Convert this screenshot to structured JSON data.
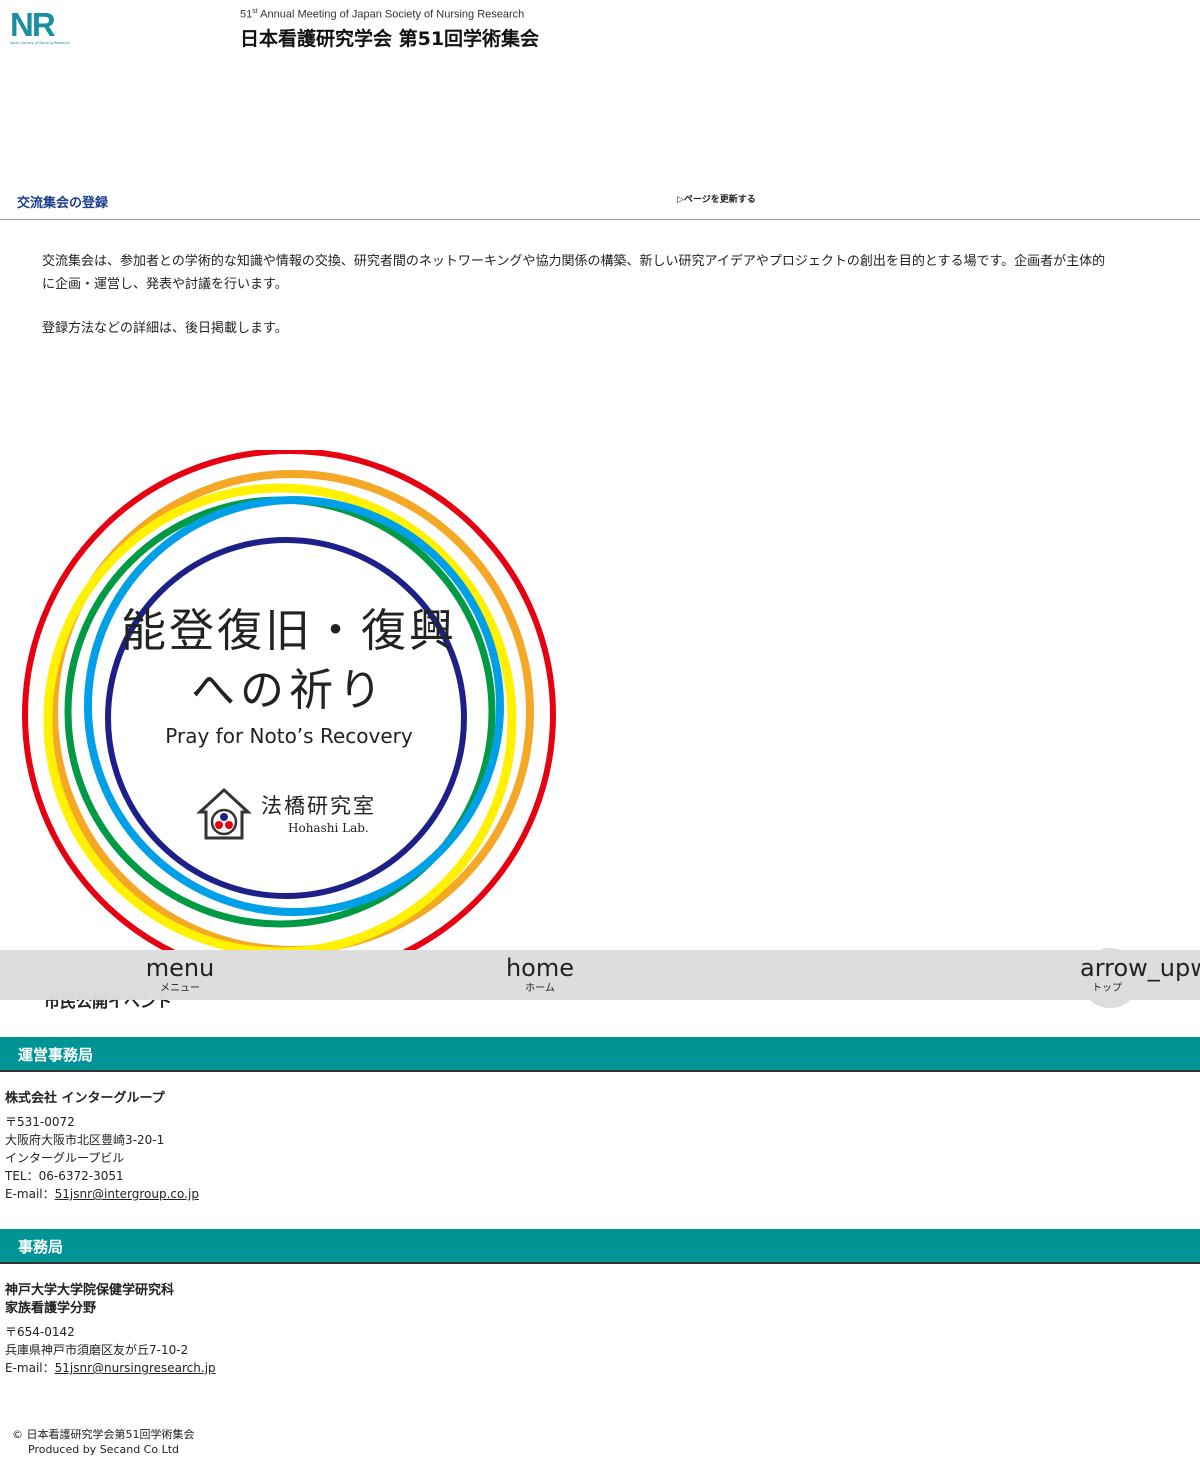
{
  "header": {
    "logo_text": "NR",
    "logo_sub": "Japan Society of Nursing Research",
    "subtitle_num": "51",
    "subtitle_sup": "st",
    "subtitle_rest": " Annual Meeting of Japan Society of Nursing Research",
    "site_title": "日本看護研究学会 第51回学術集会"
  },
  "page": {
    "heading": "交流集会の登録",
    "refresh_link": "▷ページを更新する",
    "intro_p1": "交流集会は、参加者との学術的な知識や情報の交換、研究者間のネットワーキングや協力関係の構築、新しい研究アイデアやプロジェクトの創出を目的とする場です。企画者が主体的に企画・運営し、発表や討議を行います。",
    "intro_p2": "登録方法などの詳細は、後日掲載します。"
  },
  "banner": {
    "line1": "能登復旧・復興",
    "line2": "への祈り",
    "line3": "Pray for Noto’s Recovery",
    "lab_jp": "法橋研究室",
    "lab_en": "Hohashi Lab.",
    "ring_colors": [
      "#e60012",
      "#f39800",
      "#fff100",
      "#009944",
      "#00a0e9",
      "#1d2088"
    ]
  },
  "partially_hidden_text": "市民公開イベント",
  "navbar": {
    "menu_icon": "menu",
    "menu_label": "メニュー",
    "home_icon": "home",
    "home_label": "ホーム",
    "top_icon": "arrow_upw",
    "top_label": "トップ"
  },
  "office": {
    "heading": "運営事務局",
    "org": "株式会社 インターグループ",
    "zip": "〒531-0072",
    "address1": "大阪府大阪市北区豊崎3-20-1",
    "address2": "インターグループビル",
    "tel": "TEL：06-6372-3051",
    "email_label": "E-mail：",
    "email": "51jsnr@intergroup.co.jp"
  },
  "secretariat": {
    "heading": "事務局",
    "org1": "神戸大学大学院保健学研究科",
    "org2": "家族看護学分野",
    "zip": "〒654-0142",
    "address1": "兵庫県神戸市須磨区友が丘7-10-2",
    "email_label": "E-mail：",
    "email": "51jsnr@nursingresearch.jp"
  },
  "footer": {
    "copyright": "© 日本看護研究学会第51回学術集会",
    "produced": "Produced by Secand Co Ltd"
  },
  "colors": {
    "accent": "#009494",
    "heading_blue": "#1b3f8f",
    "navbar": "#dcdcdc"
  }
}
